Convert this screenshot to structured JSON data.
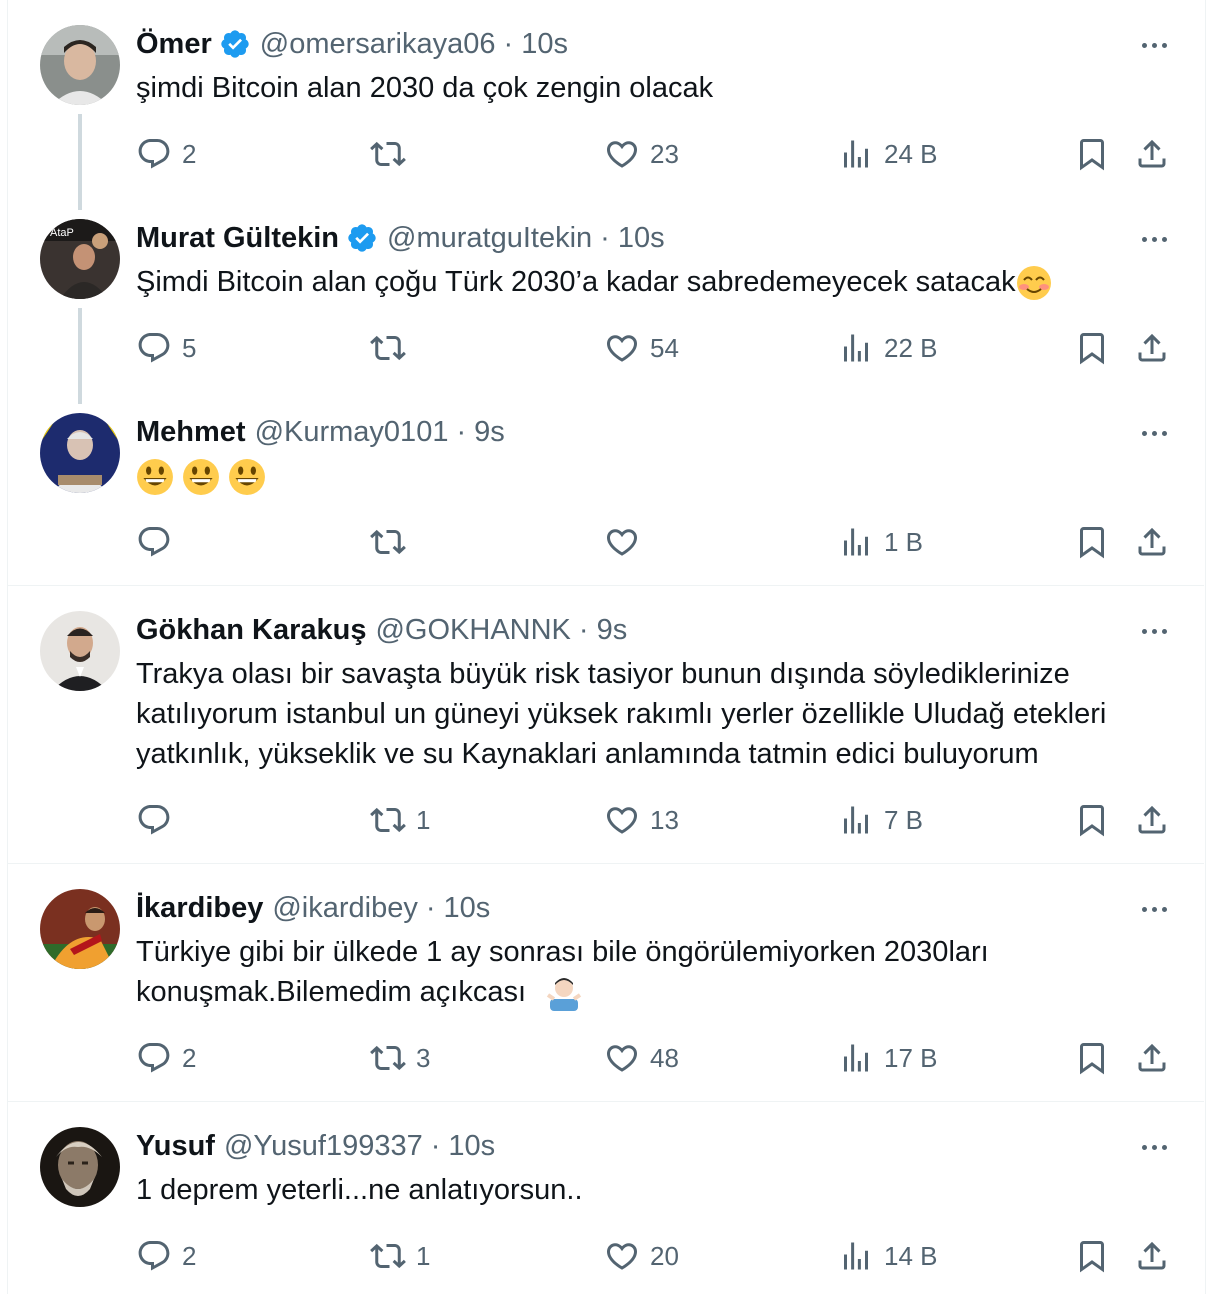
{
  "tweets": [
    {
      "name": "Ömer",
      "verified": true,
      "handle": "@omersarikaya06",
      "time": "10s",
      "text": "şimdi Bitcoin alan 2030 da çok zengin olacak",
      "replies": "2",
      "retweets": "",
      "likes": "23",
      "views": "24 B"
    },
    {
      "name": "Murat Gültekin",
      "verified": true,
      "handle": "@muratguItekin",
      "time": "10s",
      "text": "Şimdi Bitcoin alan çoğu Türk 2030’a kadar sabredemeyecek satacak",
      "replies": "5",
      "retweets": "",
      "likes": "54",
      "views": "22 B"
    },
    {
      "name": "Mehmet",
      "verified": false,
      "handle": "@Kurmay0101",
      "time": "9s",
      "text": "",
      "replies": "",
      "retweets": "",
      "likes": "",
      "views": "1 B"
    },
    {
      "name": "Gökhan Karakuş",
      "verified": false,
      "handle": "@GOKHANNK",
      "time": "9s",
      "text_lines": [
        "Trakya olası bir savaşta büyük risk tasiyor bunun dışında söylediklerinize",
        "katılıyorum istanbul un güneyi yüksek rakımlı yerler özellikle Uludağ etekleri",
        "yatkınlık, yükseklik ve su Kaynaklari anlamında tatmin edici buluyorum"
      ],
      "replies": "",
      "retweets": "1",
      "likes": "13",
      "views": "7 B"
    },
    {
      "name": "İkardibey",
      "verified": false,
      "handle": "@ikardibey",
      "time": "10s",
      "text_lines": [
        "Türkiye gibi bir ülkede 1 ay sonrası bile öngörülemiyorken 2030ları",
        "konuşmak.Bilemedim açıkcası"
      ],
      "replies": "2",
      "retweets": "3",
      "likes": "48",
      "views": "17 B"
    },
    {
      "name": "Yusuf",
      "verified": false,
      "handle": "@Yusuf199337",
      "time": "10s",
      "text": "1 deprem yeterli...ne anlatıyorsun..",
      "replies": "2",
      "retweets": "1",
      "likes": "20",
      "views": "14 B"
    }
  ],
  "separator": "·",
  "icons": {
    "reply": "reply-icon",
    "retweet": "retweet-icon",
    "like": "heart-icon",
    "views": "views-icon",
    "bookmark": "bookmark-icon",
    "share": "share-icon",
    "more": "more-icon",
    "verified": "verified-badge-icon"
  },
  "colors": {
    "text": "#0f1419",
    "muted": "#536471",
    "verified": "#1d9bf0",
    "border": "#eff3f4",
    "thread": "#cfd9de"
  }
}
